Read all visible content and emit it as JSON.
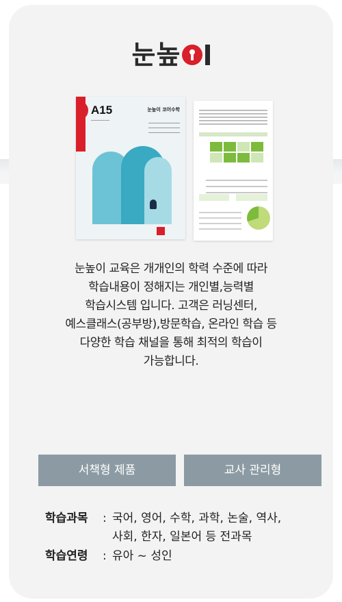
{
  "brand": {
    "logo_text": "눈높",
    "logo_mark_icon": "red-circle-keyhole-icon",
    "accent_color": "#d91f2a"
  },
  "products": [
    {
      "kind": "book-cover",
      "level": "A15",
      "brand_label": "눈높이 코어수학"
    },
    {
      "kind": "report-sheet"
    }
  ],
  "description": [
    "눈높이 교육은 개개인의 학력 수준에 따라",
    "학습내용이 정해지는 개인별,능력별",
    "학습시스템 입니다. 고객은 러닝센터,",
    "예스클래스(공부방),방문학습, 온라인 학습 등",
    "다양한 학습 채널을 통해 최적의 학습이",
    "가능합니다."
  ],
  "buttons": {
    "book_product": "서책형 제품",
    "teacher_managed": "교사 관리형",
    "color": "#8c9ba3"
  },
  "info": {
    "subjects_label": "학습과목",
    "subjects_line1": "국어, 영어, 수학,  과학, 논술, 역사,",
    "subjects_line2": "사회, 한자, 일본어 등 전과목",
    "age_label": "학습연령",
    "age_value": "유아 ~ 성인",
    "separator": ":"
  }
}
